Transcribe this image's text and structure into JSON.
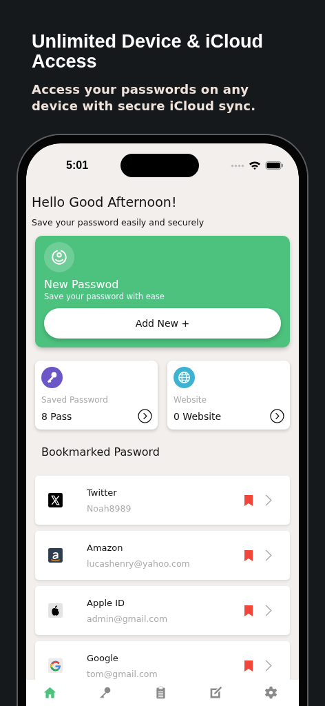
{
  "headline": {
    "title": "Unlimited Device & iCloud Access",
    "subtitle": "Access your passwords on any device with secure iCloud sync."
  },
  "status_bar": {
    "time": "5:01"
  },
  "greeting": {
    "title": "Hello Good Afternoon!",
    "subtitle": "Save your password easily and securely"
  },
  "new_password_card": {
    "title": "New Passwod",
    "subtitle": "Save your password with ease",
    "button": "Add New +"
  },
  "stats": [
    {
      "kind": "key",
      "color": "#6a56c6",
      "label": "Saved Password",
      "value": "8 Pass"
    },
    {
      "kind": "globe",
      "color": "#3db3d1",
      "label": "Website",
      "value": "0 Website"
    }
  ],
  "bookmarks": {
    "title": "Bookmarked Pasword",
    "items": [
      {
        "kind": "x",
        "name": "Twitter",
        "account": "Noah8989",
        "bookmarked": true
      },
      {
        "kind": "amazon",
        "name": "Amazon",
        "account": "lucashenry@yahoo.com",
        "bookmarked": true
      },
      {
        "kind": "apple",
        "name": "Apple ID",
        "account": "admin@gmail.com",
        "bookmarked": true
      },
      {
        "kind": "google",
        "name": "Google",
        "account": "tom@gmail.com",
        "bookmarked": true
      }
    ]
  },
  "tab_bar": [
    {
      "kind": "home",
      "selected": true
    },
    {
      "kind": "key",
      "selected": false
    },
    {
      "kind": "clipboard",
      "selected": false
    },
    {
      "kind": "edit",
      "selected": false
    },
    {
      "kind": "settings",
      "selected": false
    }
  ]
}
